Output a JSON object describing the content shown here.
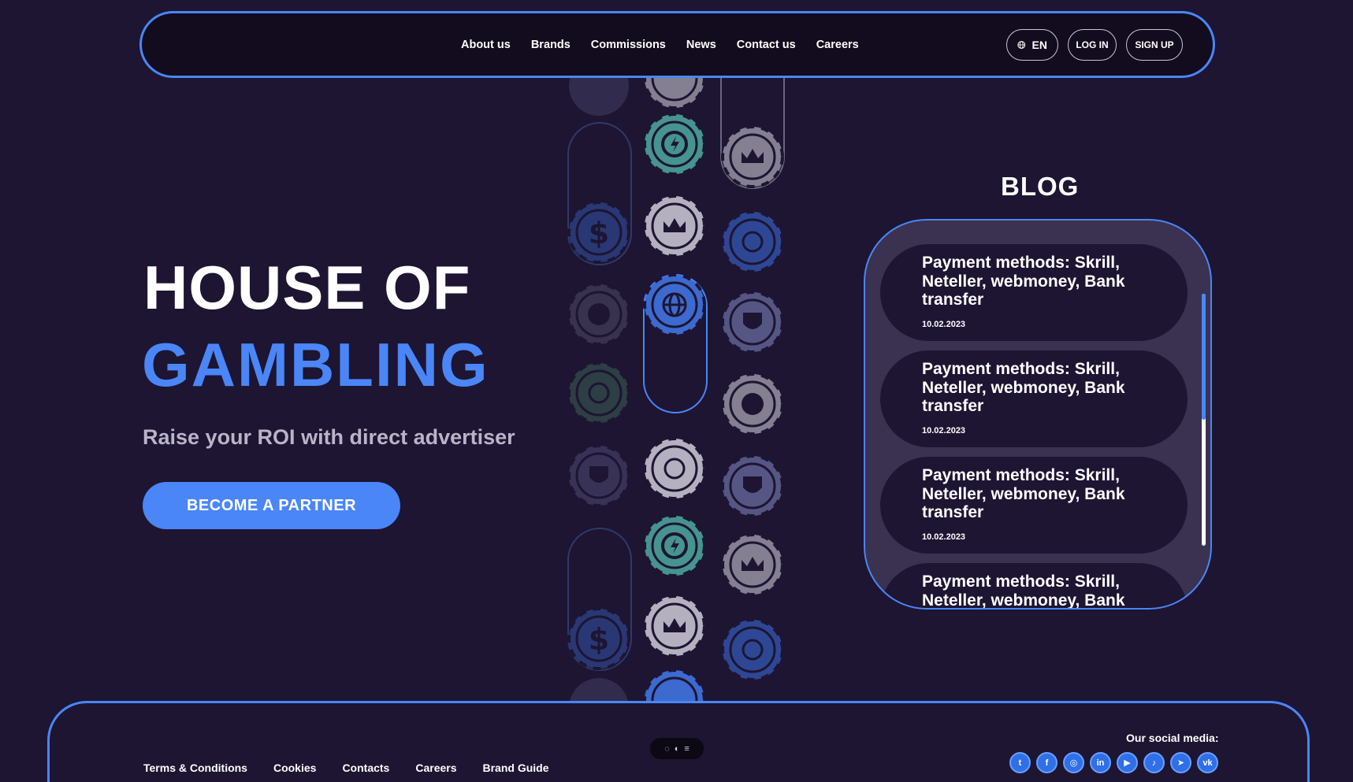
{
  "header": {
    "nav": [
      "About us",
      "Brands",
      "Commissions",
      "News",
      "Contact us",
      "Careers"
    ],
    "lang": "EN",
    "login": "LOG IN",
    "signup": "SIGN UP"
  },
  "hero": {
    "title_line1": "HOUSE OF",
    "title_line2": "GAMBLING",
    "subtitle": "Raise your ROI with direct advertiser",
    "cta": "BECOME A PARTNER"
  },
  "blog": {
    "title": "BLOG",
    "posts": [
      {
        "title": "Payment methods: Skrill, Neteller, webmoney, Bank transfer",
        "date": "10.02.2023"
      },
      {
        "title": "Payment methods: Skrill, Neteller, webmoney, Bank transfer",
        "date": "10.02.2023"
      },
      {
        "title": "Payment methods: Skrill, Neteller, webmoney, Bank transfer",
        "date": "10.02.2023"
      },
      {
        "title": "Payment methods: Skrill, Neteller, webmoney, Bank transfer",
        "date": ""
      }
    ]
  },
  "footer": {
    "links": [
      "Terms & Conditions",
      "Cookies",
      "Contacts",
      "Careers",
      "Brand Guide"
    ],
    "social_label": "Our social media:",
    "socials": [
      "twitter-icon",
      "facebook-icon",
      "instagram-icon",
      "linkedin-icon",
      "youtube-icon",
      "tiktok-icon",
      "telegram-icon",
      "vk-icon"
    ]
  },
  "colors": {
    "accent": "#4a86f7",
    "background": "#1d1532",
    "header_bg": "#120c1e",
    "blog_box": "#3a3250",
    "blog_card": "#1e1533"
  }
}
